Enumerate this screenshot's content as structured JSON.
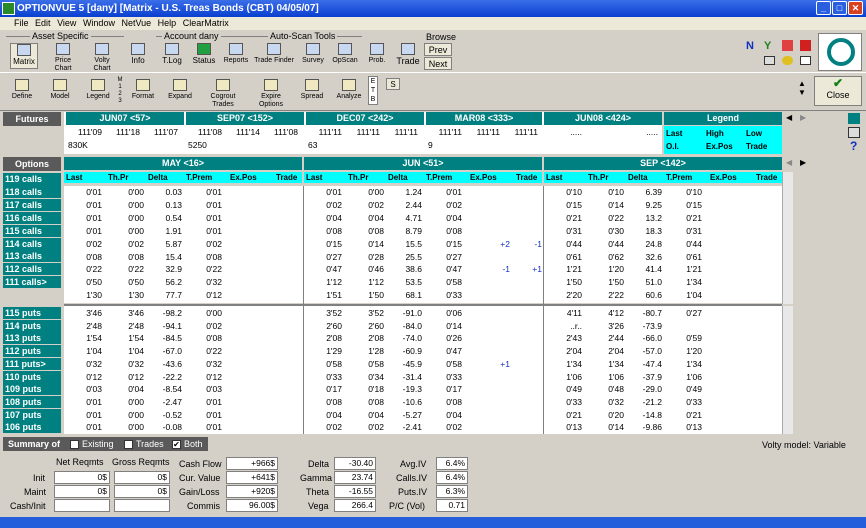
{
  "window": {
    "title": "OPTIONVUE 5   [dany]   [Matrix - U.S. Treas Bonds (CBT)  04/05/07]"
  },
  "menu": [
    "File",
    "Edit",
    "View",
    "Window",
    "NetVue",
    "Help",
    "ClearMatrix"
  ],
  "toolbar": {
    "groups": {
      "asset": "Asset Specific",
      "account": "Account dany",
      "autoscan": "Auto-Scan Tools",
      "browse": "Browse"
    },
    "buttons": [
      "Matrix",
      "Price Chart",
      "Volty Chart",
      "Info",
      "T.Log",
      "Status",
      "Reports",
      "Trade Finder",
      "Survey",
      "OpScan",
      "Prob.",
      "Trade"
    ],
    "browse_prev": "Prev",
    "browse_next": "Next",
    "row2": [
      "Define",
      "Model",
      "Legend",
      "Format",
      "Expand",
      "Cogrout Trades",
      "Expire Options",
      "Spread",
      "Analyze"
    ],
    "mode_letters": "M 1 2 3",
    "etb": "E T B",
    "s_label": "S",
    "close": "Close"
  },
  "futures": {
    "label": "Futures",
    "months": [
      "JUN07 <57>",
      "SEP07 <152>",
      "DEC07 <242>",
      "MAR08 <333>",
      "JUN08 <424>"
    ],
    "legend_title": "Legend",
    "rows": [
      [
        "111'09",
        "111'18",
        "111'07",
        "111'08",
        "111'14",
        "111'08",
        "111'11",
        "111'11",
        "111'11",
        "111'11",
        "111'11",
        "111'11",
        ".....",
        "",
        ".....",
        ""
      ],
      [
        "830K",
        "",
        "",
        "5250",
        "",
        "",
        "63",
        "",
        "",
        "9",
        "",
        "",
        "",
        "",
        "",
        ""
      ]
    ],
    "legend": [
      "Last",
      "High",
      "Low",
      "O.I.",
      "Ex.Pos",
      "Trade"
    ]
  },
  "options": {
    "label": "Options",
    "months": [
      "MAY <16>",
      "JUN <51>",
      "SEP <142>"
    ],
    "cols": [
      "Last",
      "Th.Pr",
      "Delta",
      "T.Prem",
      "Ex.Pos",
      "Trade"
    ],
    "calls": [
      {
        "s": "119 calls",
        "may": [
          "0'01",
          "0'00",
          "0.03",
          "0'01",
          "",
          ""
        ],
        "jun": [
          "0'01",
          "0'00",
          "1.24",
          "0'01",
          "",
          ""
        ],
        "sep": [
          "0'10",
          "0'10",
          "6.39",
          "0'10",
          "",
          ""
        ]
      },
      {
        "s": "118 calls",
        "may": [
          "0'01",
          "0'00",
          "0.13",
          "0'01",
          "",
          ""
        ],
        "jun": [
          "0'02",
          "0'02",
          "2.44",
          "0'02",
          "",
          ""
        ],
        "sep": [
          "0'15",
          "0'14",
          "9.25",
          "0'15",
          "",
          ""
        ]
      },
      {
        "s": "117 calls",
        "may": [
          "0'01",
          "0'00",
          "0.54",
          "0'01",
          "",
          ""
        ],
        "jun": [
          "0'04",
          "0'04",
          "4.71",
          "0'04",
          "",
          ""
        ],
        "sep": [
          "0'21",
          "0'22",
          "13.2",
          "0'21",
          "",
          ""
        ]
      },
      {
        "s": "116 calls",
        "may": [
          "0'01",
          "0'00",
          "1.91",
          "0'01",
          "",
          ""
        ],
        "jun": [
          "0'08",
          "0'08",
          "8.79",
          "0'08",
          "",
          ""
        ],
        "sep": [
          "0'31",
          "0'30",
          "18.3",
          "0'31",
          "",
          ""
        ]
      },
      {
        "s": "115 calls",
        "may": [
          "0'02",
          "0'02",
          "5.87",
          "0'02",
          "",
          ""
        ],
        "jun": [
          "0'15",
          "0'14",
          "15.5",
          "0'15",
          "+2",
          "-1"
        ],
        "sep": [
          "0'44",
          "0'44",
          "24.8",
          "0'44",
          "",
          ""
        ]
      },
      {
        "s": "114 calls",
        "may": [
          "0'08",
          "0'08",
          "15.4",
          "0'08",
          "",
          ""
        ],
        "jun": [
          "0'27",
          "0'28",
          "25.5",
          "0'27",
          "",
          ""
        ],
        "sep": [
          "0'61",
          "0'62",
          "32.6",
          "0'61",
          "",
          ""
        ]
      },
      {
        "s": "113 calls",
        "may": [
          "0'22",
          "0'22",
          "32.9",
          "0'22",
          "",
          ""
        ],
        "jun": [
          "0'47",
          "0'46",
          "38.6",
          "0'47",
          "-1",
          "+1"
        ],
        "sep": [
          "1'21",
          "1'20",
          "41.4",
          "1'21",
          "",
          ""
        ]
      },
      {
        "s": "112 calls",
        "may": [
          "0'50",
          "0'50",
          "56.2",
          "0'32",
          "",
          ""
        ],
        "jun": [
          "1'12",
          "1'12",
          "53.5",
          "0'58",
          "",
          ""
        ],
        "sep": [
          "1'50",
          "1'50",
          "51.0",
          "1'34",
          "",
          ""
        ]
      },
      {
        "s": "111 calls>",
        "may": [
          "1'30",
          "1'30",
          "77.7",
          "0'12",
          "",
          ""
        ],
        "jun": [
          "1'51",
          "1'50",
          "68.1",
          "0'33",
          "",
          ""
        ],
        "sep": [
          "2'20",
          "2'22",
          "60.6",
          "1'04",
          "",
          ""
        ]
      }
    ],
    "puts": [
      {
        "s": "115 puts",
        "may": [
          "3'46",
          "3'46",
          "-98.2",
          "0'00",
          "",
          ""
        ],
        "jun": [
          "3'52",
          "3'52",
          "-91.0",
          "0'06",
          "",
          ""
        ],
        "sep": [
          "4'11",
          "4'12",
          "-80.7",
          "0'27",
          "",
          ""
        ]
      },
      {
        "s": "114 puts",
        "may": [
          "2'48",
          "2'48",
          "-94.1",
          "0'02",
          "",
          ""
        ],
        "jun": [
          "2'60",
          "2'60",
          "-84.0",
          "0'14",
          "",
          ""
        ],
        "sep": [
          "..r..",
          "3'26",
          "-73.9",
          "",
          "",
          ""
        ]
      },
      {
        "s": "113 puts",
        "may": [
          "1'54",
          "1'54",
          "-84.5",
          "0'08",
          "",
          ""
        ],
        "jun": [
          "2'08",
          "2'08",
          "-74.0",
          "0'26",
          "",
          ""
        ],
        "sep": [
          "2'43",
          "2'44",
          "-66.0",
          "0'59",
          "",
          ""
        ]
      },
      {
        "s": "112 puts",
        "may": [
          "1'04",
          "1'04",
          "-67.0",
          "0'22",
          "",
          ""
        ],
        "jun": [
          "1'29",
          "1'28",
          "-60.9",
          "0'47",
          "",
          ""
        ],
        "sep": [
          "2'04",
          "2'04",
          "-57.0",
          "1'20",
          "",
          ""
        ]
      },
      {
        "s": "111 puts>",
        "may": [
          "0'32",
          "0'32",
          "-43.6",
          "0'32",
          "",
          ""
        ],
        "jun": [
          "0'58",
          "0'58",
          "-45.9",
          "0'58",
          "+1",
          ""
        ],
        "sep": [
          "1'34",
          "1'34",
          "-47.4",
          "1'34",
          "",
          ""
        ]
      },
      {
        "s": "110 puts",
        "may": [
          "0'12",
          "0'12",
          "-22.2",
          "0'12",
          "",
          ""
        ],
        "jun": [
          "0'33",
          "0'34",
          "-31.4",
          "0'33",
          "",
          ""
        ],
        "sep": [
          "1'06",
          "1'06",
          "-37.9",
          "1'06",
          "",
          ""
        ]
      },
      {
        "s": "109 puts",
        "may": [
          "0'03",
          "0'04",
          "-8.54",
          "0'03",
          "",
          ""
        ],
        "jun": [
          "0'17",
          "0'18",
          "-19.3",
          "0'17",
          "",
          ""
        ],
        "sep": [
          "0'49",
          "0'48",
          "-29.0",
          "0'49",
          "",
          ""
        ]
      },
      {
        "s": "108 puts",
        "may": [
          "0'01",
          "0'00",
          "-2.47",
          "0'01",
          "",
          ""
        ],
        "jun": [
          "0'08",
          "0'08",
          "-10.6",
          "0'08",
          "",
          ""
        ],
        "sep": [
          "0'33",
          "0'32",
          "-21.2",
          "0'33",
          "",
          ""
        ]
      },
      {
        "s": "107 puts",
        "may": [
          "0'01",
          "0'00",
          "-0.52",
          "0'01",
          "",
          ""
        ],
        "jun": [
          "0'04",
          "0'04",
          "-5.27",
          "0'04",
          "",
          ""
        ],
        "sep": [
          "0'21",
          "0'20",
          "-14.8",
          "0'21",
          "",
          ""
        ]
      },
      {
        "s": "106 puts",
        "may": [
          "0'01",
          "0'00",
          "-0.08",
          "0'01",
          "",
          ""
        ],
        "jun": [
          "0'02",
          "0'02",
          "-2.41",
          "0'02",
          "",
          ""
        ],
        "sep": [
          "0'13",
          "0'14",
          "-9.86",
          "0'13",
          "",
          ""
        ]
      }
    ]
  },
  "summary": {
    "label": "Summary of",
    "chk_existing": "Existing",
    "chk_trades": "Trades",
    "chk_both": "Both",
    "volty": "Volty model: Variable",
    "net_hdr": "Net Reqmts",
    "gross_hdr": "Gross Reqmts",
    "init": "Init",
    "maint": "Maint",
    "cash_init": "Cash/Init",
    "net_init": "0$",
    "net_maint": "0$",
    "gross_init": "0$",
    "gross_maint": "0$",
    "cashflow_l": "Cash Flow",
    "cashflow": "+966$",
    "curval_l": "Cur. Value",
    "curval": "+641$",
    "gainloss_l": "Gain/Loss",
    "gainloss": "+920$",
    "commis_l": "Commis",
    "commis": "96.00$",
    "delta_l": "Delta",
    "delta": "-30.40",
    "gamma_l": "Gamma",
    "gamma": "23.74",
    "theta_l": "Theta",
    "theta": "-16.55",
    "vega_l": "Vega",
    "vega": "266.4",
    "avgiv_l": "Avg.IV",
    "avgiv": "6.4%",
    "callsiv_l": "Calls.IV",
    "callsiv": "6.4%",
    "putsiv_l": "Puts.IV",
    "putsiv": "6.3%",
    "pc_l": "P/C (Vol)",
    "pc": "0.71"
  }
}
